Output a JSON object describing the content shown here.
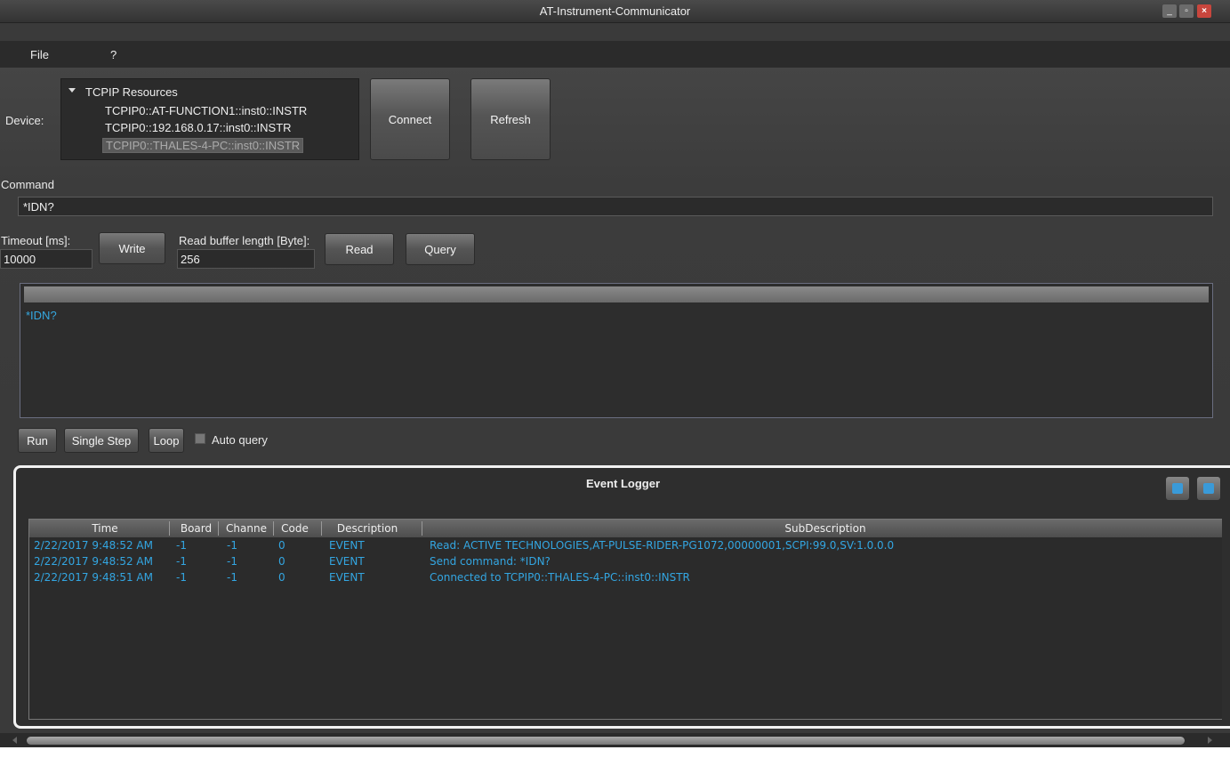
{
  "window": {
    "title": "AT-Instrument-Communicator"
  },
  "menu": {
    "items": [
      "File",
      "?"
    ]
  },
  "device": {
    "label": "Device:",
    "tree_root": "TCPIP Resources",
    "resources": [
      "TCPIP0::AT-FUNCTION1::inst0::INSTR",
      "TCPIP0::192.168.0.17::inst0::INSTR",
      "TCPIP0::THALES-4-PC::inst0::INSTR"
    ],
    "selected_index": 2,
    "connect_label": "Connect",
    "refresh_label": "Refresh"
  },
  "command": {
    "label": "Command",
    "value": "*IDN?"
  },
  "io": {
    "timeout_label": "Timeout [ms]:",
    "timeout_value": "10000",
    "write_label": "Write",
    "buffer_label": "Read buffer length [Byte]:",
    "buffer_value": "256",
    "read_label": "Read",
    "query_label": "Query"
  },
  "script": {
    "text": "*IDN?"
  },
  "run_controls": {
    "run_label": "Run",
    "single_step_label": "Single Step",
    "loop_label": "Loop",
    "auto_query_label": "Auto query",
    "auto_query_checked": false
  },
  "event_logger": {
    "title": "Event Logger",
    "columns": [
      "Time",
      "Board",
      "Channe",
      "Code",
      "Description",
      "SubDescription"
    ],
    "rows": [
      [
        "2/22/2017 9:48:52 AM",
        "-1",
        "-1",
        "0",
        "EVENT",
        "Read: ACTIVE TECHNOLOGIES,AT-PULSE-RIDER-PG1072,00000001,SCPI:99.0,SV:1.0.0.0"
      ],
      [
        "2/22/2017 9:48:52 AM",
        "-1",
        "-1",
        "0",
        "EVENT",
        "Send command: *IDN?"
      ],
      [
        "2/22/2017 9:48:51 AM",
        "-1",
        "-1",
        "0",
        "EVENT",
        "Connected to TCPIP0::THALES-4-PC::inst0::INSTR"
      ]
    ]
  },
  "colors": {
    "accent_text": "#33a6e2",
    "close_button": "#c9463d"
  }
}
